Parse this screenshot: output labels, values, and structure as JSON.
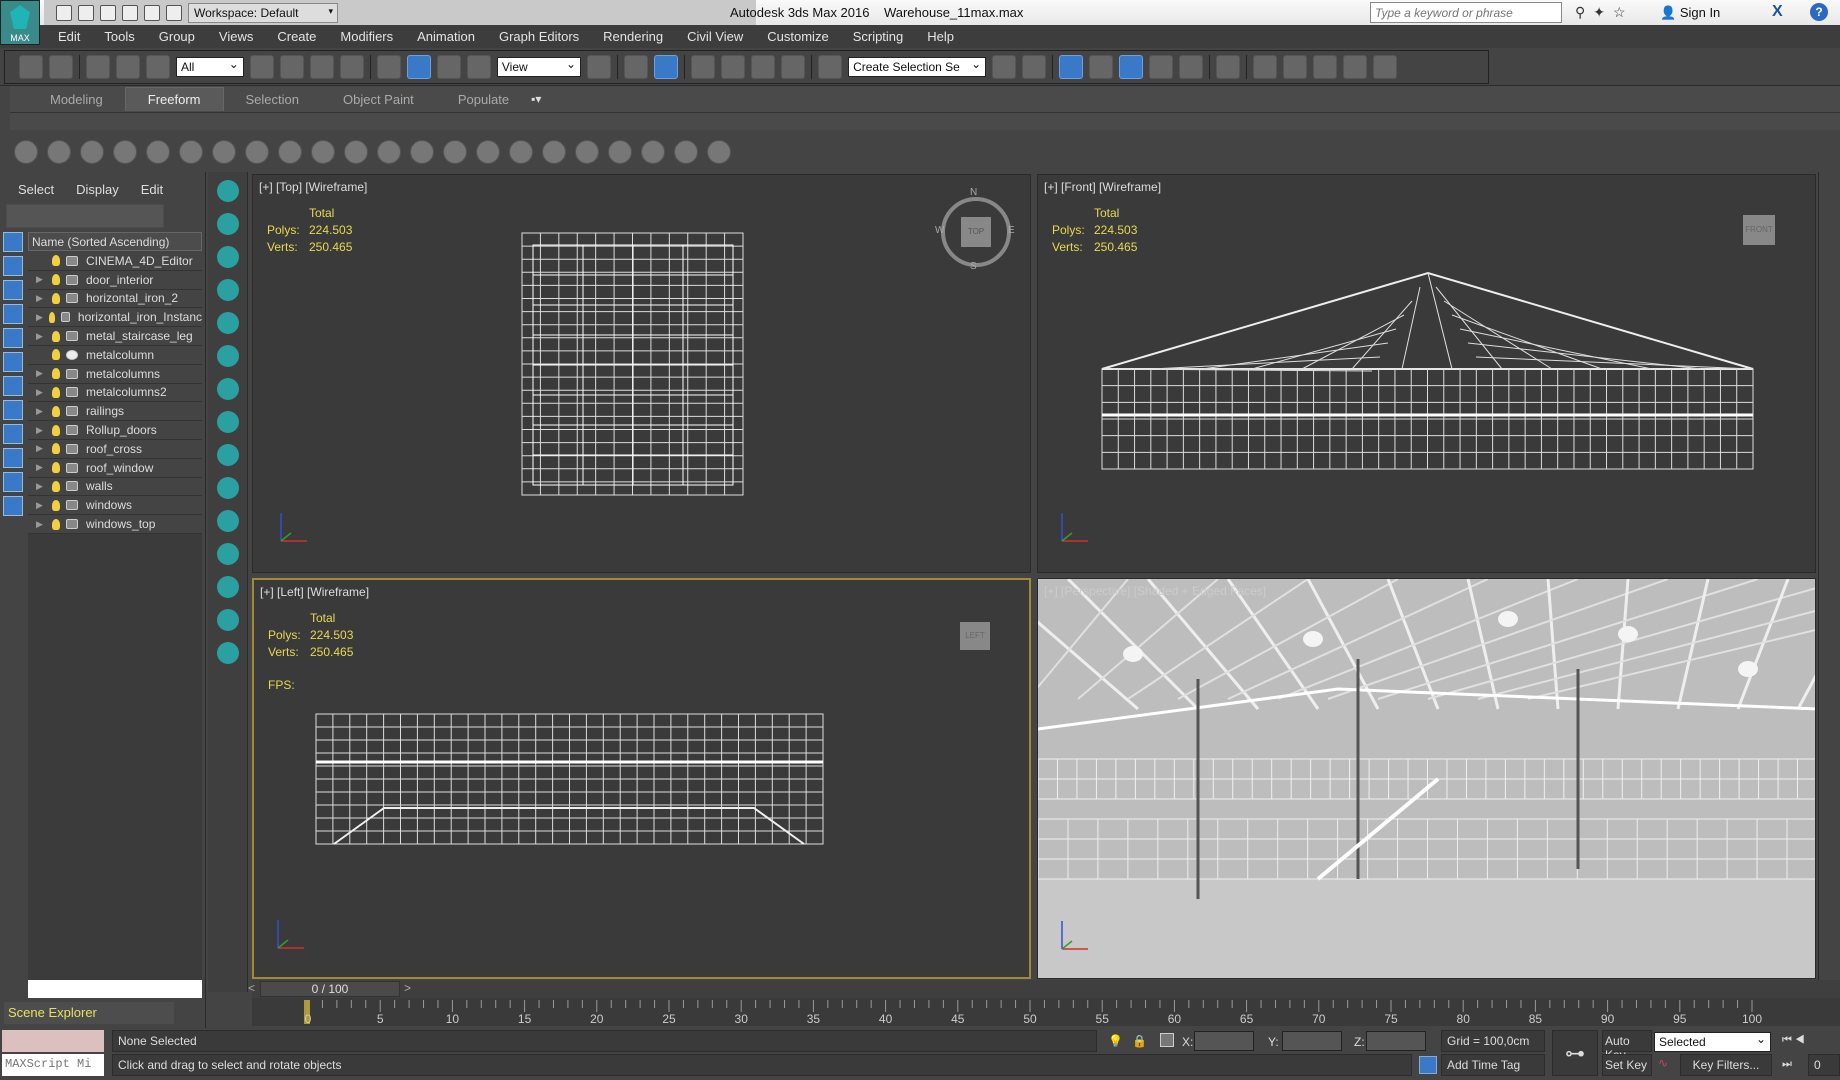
{
  "titlebar": {
    "logo": "MAX",
    "workspace": "Workspace: Default",
    "app": "Autodesk 3ds Max 2016",
    "file": "Warehouse_11max.max",
    "search_placeholder": "Type a keyword or phrase",
    "sign_in": "Sign In"
  },
  "menu": [
    "Edit",
    "Tools",
    "Group",
    "Views",
    "Create",
    "Modifiers",
    "Animation",
    "Graph Editors",
    "Rendering",
    "Civil View",
    "Customize",
    "Scripting",
    "Help"
  ],
  "main_toolbar": {
    "selection_filter": "All",
    "reference_coord": "View",
    "selection_set_placeholder": "Create Selection Se",
    "active_tool": "select-and-rotate"
  },
  "ribbon": {
    "tabs": [
      "Modeling",
      "Freeform",
      "Selection",
      "Object Paint",
      "Populate"
    ],
    "active": "Freeform"
  },
  "scene_explorer": {
    "menu": [
      "Select",
      "Display",
      "Edit"
    ],
    "column": "Name (Sorted Ascending)",
    "items": [
      {
        "name": "CINEMA_4D_Editor",
        "type": "camera",
        "exp": false
      },
      {
        "name": "door_interior",
        "type": "mesh",
        "exp": true
      },
      {
        "name": "horizontal_iron_2",
        "type": "mesh",
        "exp": true
      },
      {
        "name": "horizontal_iron_Instanc",
        "type": "mesh",
        "exp": true
      },
      {
        "name": "metal_staircase_leg",
        "type": "mesh",
        "exp": true
      },
      {
        "name": "metalcolumn",
        "type": "sphere",
        "exp": false
      },
      {
        "name": "metalcolumns",
        "type": "mesh",
        "exp": true
      },
      {
        "name": "metalcolumns2",
        "type": "mesh",
        "exp": true
      },
      {
        "name": "railings",
        "type": "mesh",
        "exp": true
      },
      {
        "name": "Rollup_doors",
        "type": "mesh",
        "exp": true
      },
      {
        "name": "roof_cross",
        "type": "mesh",
        "exp": true
      },
      {
        "name": "roof_window",
        "type": "mesh",
        "exp": true
      },
      {
        "name": "walls",
        "type": "mesh",
        "exp": true
      },
      {
        "name": "windows",
        "type": "mesh",
        "exp": true
      },
      {
        "name": "windows_top",
        "type": "mesh",
        "exp": true
      }
    ],
    "footer": "Scene Explorer"
  },
  "viewports": {
    "top": {
      "label": "[+] [Top] [Wireframe]",
      "cube": "TOP",
      "compass": [
        "N",
        "E",
        "S",
        "W"
      ]
    },
    "front": {
      "label": "[+] [Front] [Wireframe]",
      "cube": "FRONT"
    },
    "left": {
      "label": "[+] [Left] [Wireframe]",
      "cube": "LEFT",
      "fps": "FPS:"
    },
    "perspective": {
      "label": "[+] [Perspective] [Shaded + Edged Faces]"
    },
    "stats": {
      "total": "Total",
      "polys_label": "Polys:",
      "polys": "224.503",
      "verts_label": "Verts:",
      "verts": "250.465"
    }
  },
  "timeline": {
    "slider": "0 / 100",
    "ticks": [
      "0",
      "5",
      "10",
      "15",
      "20",
      "25",
      "30",
      "35",
      "40",
      "45",
      "50",
      "55",
      "60",
      "65",
      "70",
      "75",
      "80",
      "85",
      "90",
      "95",
      "100"
    ]
  },
  "status": {
    "maxscript": "MAXScript Mi",
    "selection": "None Selected",
    "prompt": "Click and drag to select and rotate objects",
    "x": "X:",
    "y": "Y:",
    "z": "Z:",
    "grid": "Grid = 100,0cm",
    "add_time_tag": "Add Time Tag",
    "auto_key": "Auto Key",
    "set_key": "Set Key",
    "key_mode": "Selected",
    "key_filters": "Key Filters...",
    "frame": "0"
  },
  "colors": {
    "accent": "#3a78c8",
    "stats": "#e8d850",
    "active_viewport": "#a08a3a"
  }
}
